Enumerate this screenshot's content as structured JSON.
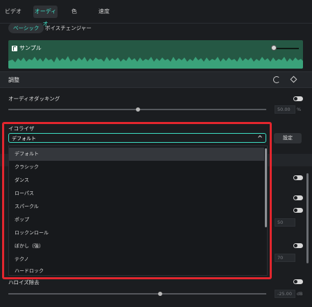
{
  "tabs": [
    {
      "label": "ビデオ"
    },
    {
      "label": "オーディオ",
      "active": true
    },
    {
      "label": "色"
    },
    {
      "label": "速度"
    }
  ],
  "subtabs": [
    {
      "label": "ベーシック",
      "active": true
    },
    {
      "label": "ボイスチェンジャー"
    }
  ],
  "clip": {
    "name": "サンプル",
    "icon": "music-note-icon"
  },
  "adjust": {
    "title": "調整"
  },
  "ducking": {
    "label": "オーディオダッキング",
    "value": "50.00",
    "unit": "%"
  },
  "equalizer": {
    "label": "イコライザ",
    "selected": "デフォルト",
    "settings_label": "設定",
    "options": [
      "デフォルト",
      "クラシック",
      "ダンス",
      "ローパス",
      "スパークル",
      "ポップ",
      "ロックンロール",
      "ぼかし（強）",
      "テクノ",
      "ハードロック"
    ]
  },
  "hidden_values": {
    "v1": "50",
    "v2": "70"
  },
  "noise": {
    "label": "ハロイズ除去",
    "value": "-25.00",
    "unit": "dB"
  },
  "colors": {
    "accent": "#3fe0c6",
    "wave": "#255844",
    "highlight": "#e3262e"
  }
}
